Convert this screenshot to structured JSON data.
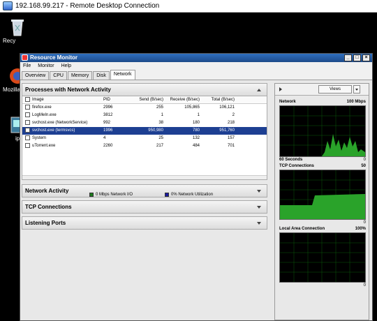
{
  "rdc": {
    "title": "192.168.99.217 - Remote Desktop Connection"
  },
  "desktop": {
    "icons": [
      {
        "label": "Recy",
        "icon": "recycle-bin-icon"
      },
      {
        "label": "Mozilla",
        "icon": "firefox-icon"
      },
      {
        "label": "ip",
        "icon": "app-icon"
      }
    ]
  },
  "rm": {
    "title": "Resource Monitor",
    "menu": [
      "File",
      "Monitor",
      "Help"
    ],
    "tabs": [
      "Overview",
      "CPU",
      "Memory",
      "Disk",
      "Network"
    ],
    "active_tab": "Network",
    "processes": {
      "title": "Processes with Network Activity",
      "columns": [
        "Image",
        "PID",
        "Send (B/sec)",
        "Receive (B/sec)",
        "Total (B/sec)"
      ],
      "rows": [
        {
          "image": "firefox.exe",
          "pid": "2996",
          "send": "255",
          "receive": "105,865",
          "total": "106,121",
          "selected": false
        },
        {
          "image": "LogMeIn.exe",
          "pid": "3812",
          "send": "1",
          "receive": "1",
          "total": "2",
          "selected": false
        },
        {
          "image": "svchost.exe (NetworkService)",
          "pid": "992",
          "send": "38",
          "receive": "180",
          "total": "218",
          "selected": false
        },
        {
          "image": "svchost.exe (termsvcs)",
          "pid": "1996",
          "send": "950,980",
          "receive": "780",
          "total": "951,760",
          "selected": true
        },
        {
          "image": "System",
          "pid": "4",
          "send": "25",
          "receive": "132",
          "total": "157",
          "selected": false
        },
        {
          "image": "uTorrent.exe",
          "pid": "2260",
          "send": "217",
          "receive": "484",
          "total": "701",
          "selected": false
        }
      ]
    },
    "network_activity": {
      "title": "Network Activity",
      "legend1": "0 Mbps Network I/O",
      "legend1_color": "#1e7a1e",
      "legend2": "0% Network Utilization",
      "legend2_color": "#1a1aa0"
    },
    "tcp": {
      "title": "TCP Connections"
    },
    "listening": {
      "title": "Listening Ports"
    },
    "graphs": {
      "views_label": "Views",
      "network": {
        "title": "Network",
        "max": "100 Mbps",
        "foot_left": "60 Seconds",
        "foot_right": "0"
      },
      "tcp": {
        "title": "TCP Connections",
        "max": "50",
        "foot_right": "0"
      },
      "lan": {
        "title": "Local Area Connection",
        "max": "100%",
        "foot_right": "0"
      }
    }
  }
}
